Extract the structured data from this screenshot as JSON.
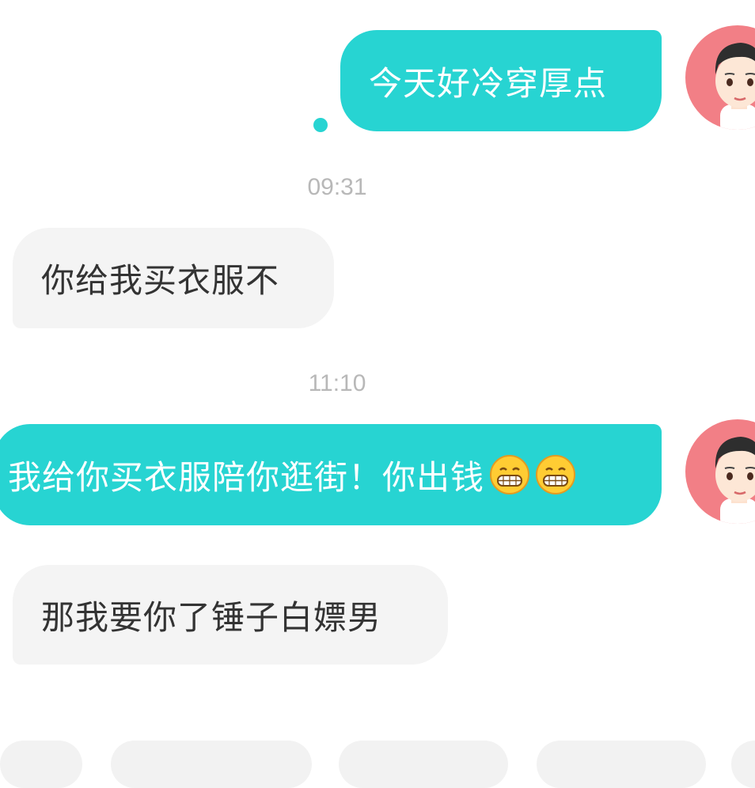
{
  "conversation": {
    "messages": [
      {
        "direction": "outgoing",
        "text": "今天好冷穿厚点",
        "status": "unread-dot"
      },
      {
        "type": "timestamp",
        "text": "09:31"
      },
      {
        "direction": "incoming",
        "text": "你给我买衣服不"
      },
      {
        "type": "timestamp",
        "text": "11:10"
      },
      {
        "direction": "outgoing",
        "text": "我给你买衣服陪你逛街！你出钱",
        "emoji": [
          "grinning-face-emoji",
          "grinning-face-emoji"
        ]
      },
      {
        "direction": "incoming",
        "text": "那我要你了锤子白嫖男"
      }
    ]
  },
  "colors": {
    "outgoing_bubble": "#27d4d2",
    "incoming_bubble": "#f4f4f4",
    "avatar_bg": "#f27f86",
    "timestamp_text": "#b8b8b8"
  },
  "icons": {
    "avatar": "cartoon-boy-avatar",
    "status": "unread-dot"
  }
}
